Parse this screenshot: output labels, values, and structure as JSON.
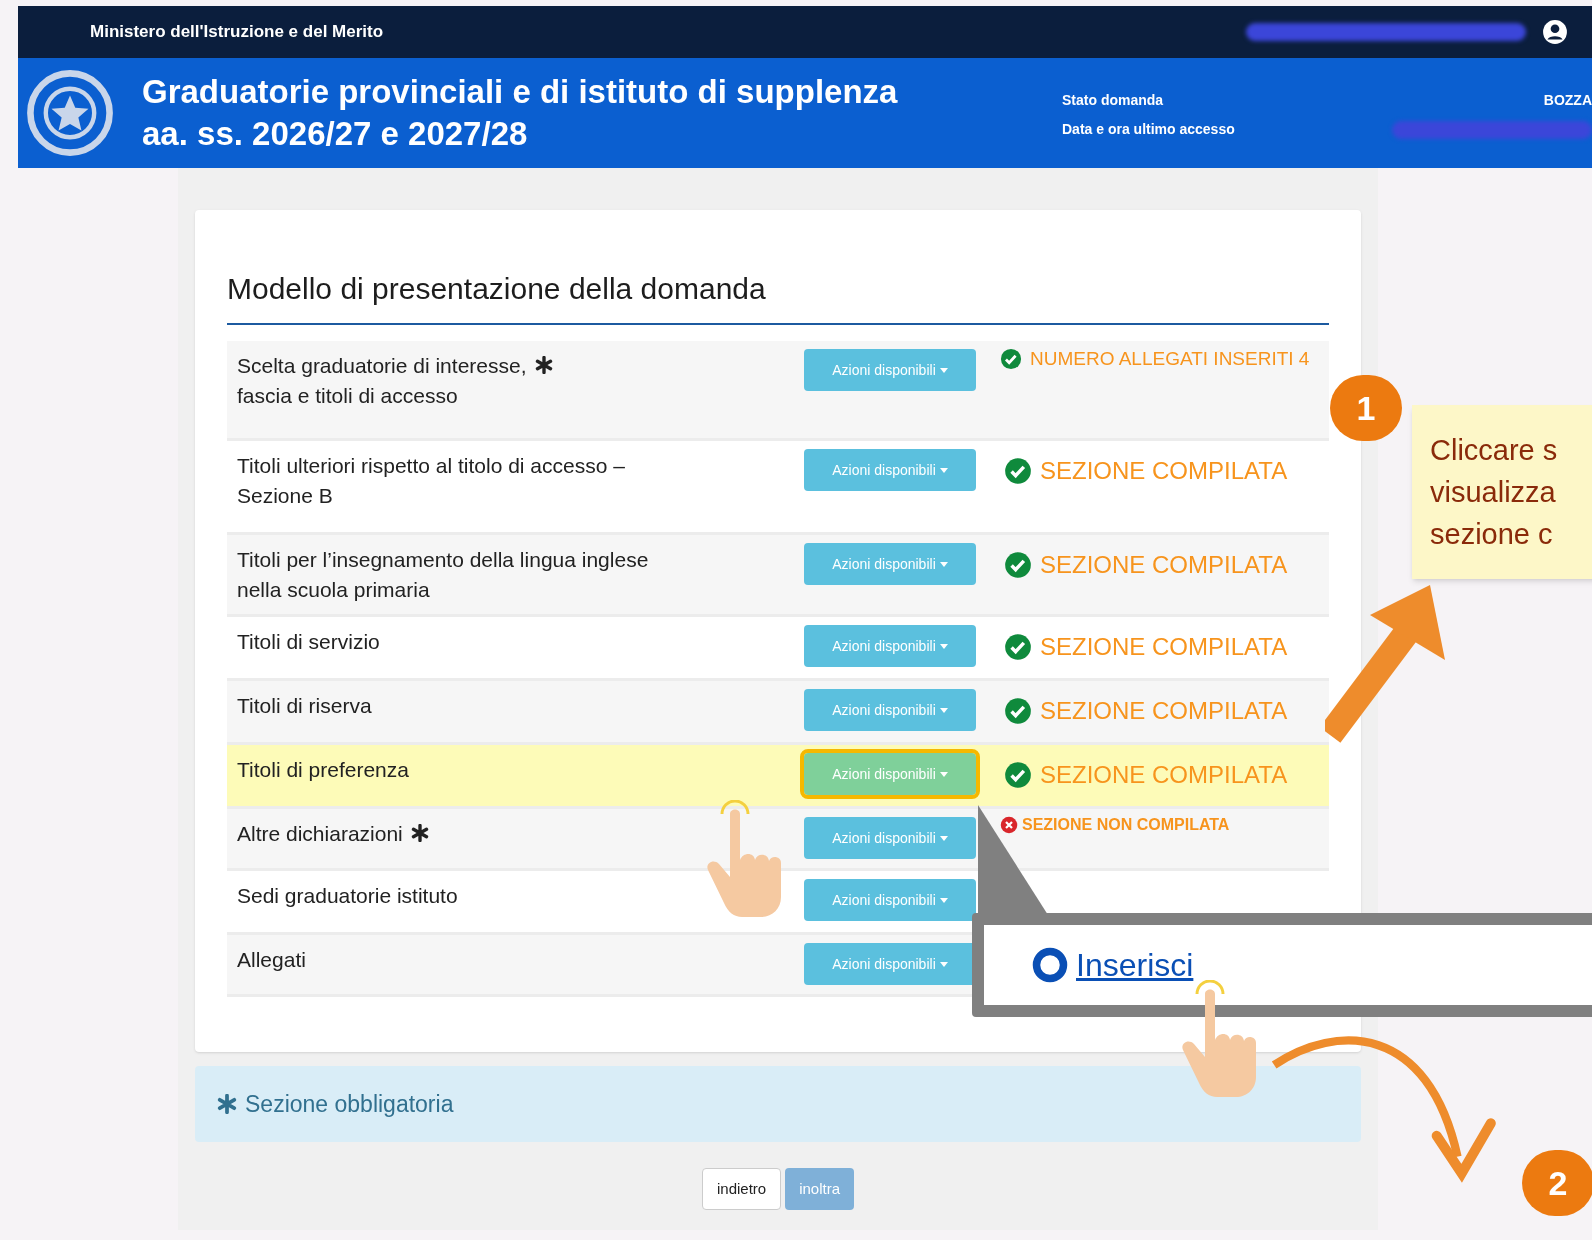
{
  "top_bar": {
    "ministry": "Ministero dell'Istruzione e del Merito"
  },
  "header": {
    "title_lines": [
      "Graduatorie provinciali e di istituto di supplenza",
      "aa. ss. 2026/27 e 2027/28"
    ],
    "info": [
      {
        "label": "Stato domanda",
        "value": "BOZZA"
      },
      {
        "label": "Data e ora ultimo accesso"
      }
    ]
  },
  "form": {
    "title": "Modello di presentazione della domanda",
    "rows": [
      {
        "label": "Scelta graduatorie di interesse,\nfascia e titoli di accesso",
        "required": true,
        "button": "Azioni disponibili",
        "selected": false,
        "status": {
          "kind": "count",
          "text": "NUMERO ALLEGATI INSERITI 4"
        }
      },
      {
        "label": "Titoli ulteriori rispetto al titolo di accesso –\nSezione B",
        "required": false,
        "button": "Azioni disponibili",
        "selected": false,
        "status": {
          "kind": "complete",
          "text": "SEZIONE COMPILATA"
        }
      },
      {
        "label": "Titoli per l’insegnamento della lingua inglese\nnella scuola primaria",
        "required": false,
        "button": "Azioni disponibili",
        "selected": false,
        "status": {
          "kind": "complete",
          "text": "SEZIONE COMPILATA"
        }
      },
      {
        "label": "Titoli di servizio",
        "required": false,
        "button": "Azioni disponibili",
        "selected": false,
        "status": {
          "kind": "complete",
          "text": "SEZIONE COMPILATA"
        }
      },
      {
        "label": "Titoli di riserva",
        "required": false,
        "button": "Azioni disponibili",
        "selected": false,
        "status": {
          "kind": "complete",
          "text": "SEZIONE COMPILATA"
        }
      },
      {
        "label": "Titoli di preferenza",
        "required": false,
        "button": "Azioni disponibili",
        "selected": true,
        "status": {
          "kind": "complete",
          "text": "SEZIONE COMPILATA"
        }
      },
      {
        "label": "Altre dichiarazioni",
        "required": true,
        "button": "Azioni disponibili",
        "selected": false,
        "status": {
          "kind": "incomplete",
          "text": "SEZIONE NON COMPILATA"
        }
      },
      {
        "label": "Sedi graduatorie istituto",
        "required": false,
        "button": "Azioni disponibili",
        "selected": false
      },
      {
        "label": "Allegati",
        "required": false,
        "button": "Azioni disponibili",
        "selected": false
      }
    ]
  },
  "notice": {
    "text": "Sezione obbligatoria"
  },
  "buttons": [
    {
      "label": "indietro",
      "disabled": false
    },
    {
      "label": "inoltra",
      "disabled": true
    }
  ],
  "menu_popup": {
    "link": "Inserisci"
  },
  "callouts": [
    {
      "number": "1",
      "lines": [
        "Cliccare s",
        "visualizza",
        "sezione c"
      ]
    },
    {
      "number": "2"
    }
  ]
}
